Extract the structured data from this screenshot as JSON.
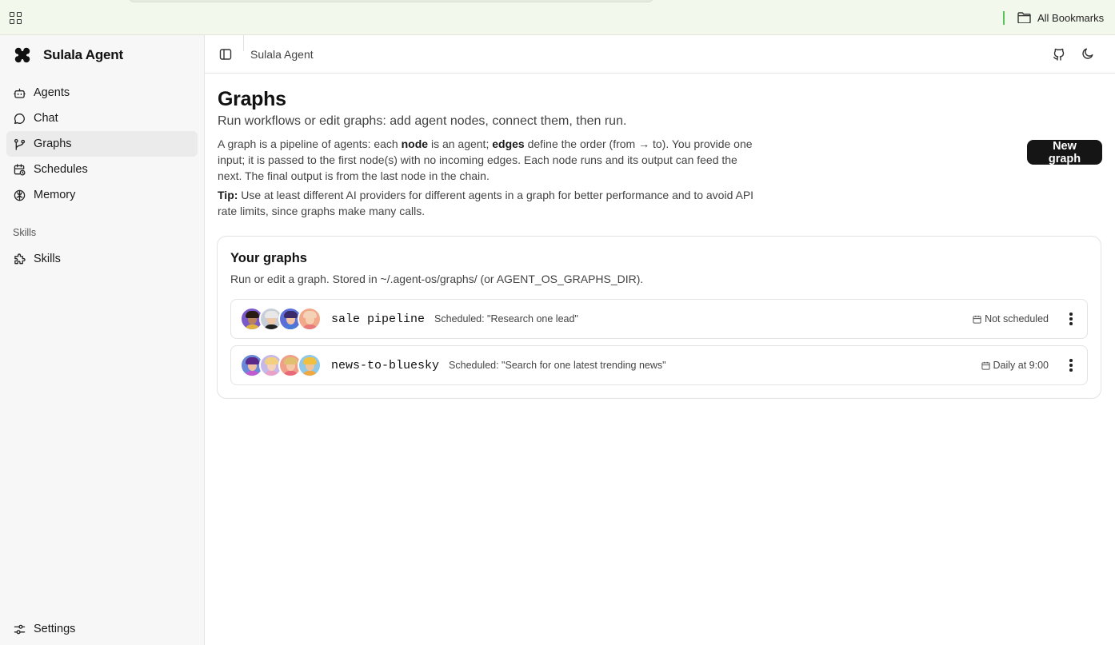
{
  "browser": {
    "bookmarks_label": "All Bookmarks"
  },
  "sidebar": {
    "brand": "Sulala Agent",
    "items": [
      {
        "label": "Agents",
        "icon": "bot-icon"
      },
      {
        "label": "Chat",
        "icon": "chat-bubble-icon"
      },
      {
        "label": "Graphs",
        "icon": "git-branch-icon",
        "active": true
      },
      {
        "label": "Schedules",
        "icon": "calendar-clock-icon"
      },
      {
        "label": "Memory",
        "icon": "brain-icon"
      }
    ],
    "section_label": "Skills",
    "skills_item": {
      "label": "Skills",
      "icon": "puzzle-icon"
    },
    "settings_label": "Settings"
  },
  "header": {
    "breadcrumb": "Sulala Agent"
  },
  "page": {
    "title": "Graphs",
    "subtitle": "Run workflows or edit graphs: add agent nodes, connect them, then run.",
    "desc_1": "A graph is a pipeline of agents: each ",
    "desc_node": "node",
    "desc_2": " is an agent; ",
    "desc_edges": "edges",
    "desc_3": " define the order (from → to). You provide one input; it is passed to the first node(s) with no incoming edges. Each node runs and its output can feed the next. The final output is from the last node in the chain.",
    "tip_label": "Tip:",
    "tip_text": " Use at least different AI providers for different agents in a graph for better performance and to avoid API rate limits, since graphs make many calls.",
    "new_graph_label": "New graph"
  },
  "graphs_card": {
    "title": "Your graphs",
    "subtitle": "Run or edit a graph. Stored in ~/.agent-os/graphs/ (or AGENT_OS_GRAPHS_DIR).",
    "rows": [
      {
        "name": "sale pipeline",
        "task": "Scheduled: \"Research one lead\"",
        "schedule": "Not scheduled",
        "avatars": [
          {
            "bg": "#7a59c9",
            "hair": "#2a1a14",
            "face": "#b8835c",
            "body": "#e0b340"
          },
          {
            "bg": "#c9cfd6",
            "hair": "#e8e8e8",
            "face": "#f0c8a8",
            "body": "#222222"
          },
          {
            "bg": "#5b6fd8",
            "hair": "#3a2a6a",
            "face": "#f2c2a2",
            "body": "#4a7ad8"
          },
          {
            "bg": "#f1a98a",
            "hair": "#f4d2b8",
            "face": "#f6cfb0",
            "body": "#e87a7a"
          }
        ]
      },
      {
        "name": "news-to-bluesky",
        "task": "Scheduled: \"Search for one latest trending news\"",
        "schedule": "Daily at 9:00",
        "avatars": [
          {
            "bg": "#6a88d8",
            "hair": "#5a2a8a",
            "face": "#f0c0a0",
            "body": "#c25ad0"
          },
          {
            "bg": "#c6b9e8",
            "hair": "#f2d080",
            "face": "#f6d2b8",
            "body": "#e8a2c8"
          },
          {
            "bg": "#f0a08a",
            "hair": "#e0c070",
            "face": "#f4c8a6",
            "body": "#e86a7a"
          },
          {
            "bg": "#8fc8e8",
            "hair": "#f0c040",
            "face": "#f0c49a",
            "body": "#f0a840"
          }
        ]
      }
    ]
  }
}
